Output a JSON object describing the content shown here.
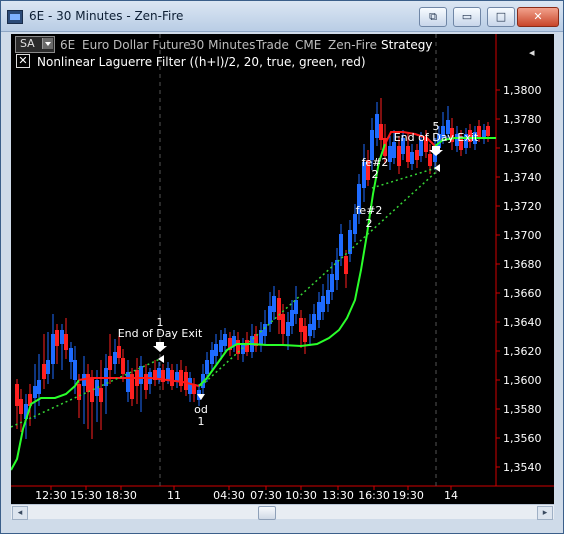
{
  "window": {
    "title": "6E - 30 Minutes - Zen-Fire",
    "min_symbol": "▭",
    "max_symbol": "□",
    "close_symbol": "✕",
    "extra_symbol": "⧉"
  },
  "header": {
    "account": "SA",
    "instrument": "6E",
    "description": "Euro Dollar Future",
    "interval": "30 Minutes",
    "type": "Trade",
    "exchange": "CME",
    "connection": "Zen-Fire",
    "mode": "Strategy",
    "indicator": "Nonlinear Laguerre Filter  ((h+l)/2,  20,  true,  green,  red)",
    "close_mark": "✕"
  },
  "axes": {
    "price_ticks": [
      "1,3800",
      "1,3780",
      "1,3760",
      "1,3740",
      "1,3720",
      "1,3700",
      "1,3680",
      "1,3660",
      "1,3640",
      "1,3620",
      "1,3600",
      "1,3580",
      "1,3560",
      "1,3540"
    ],
    "time_ticks": [
      "12:30",
      "15:30",
      "18:30",
      "11",
      "04:30",
      "07:30",
      "10:30",
      "13:30",
      "16:30",
      "19:30",
      "14"
    ],
    "pin_icon": "◂"
  },
  "annotations": {
    "exit1_label": "End of Day Exit",
    "exit1_count": "1",
    "exit2_label": "End of Day Exit",
    "exit2_count": "5",
    "entry1_label": "od",
    "entry1_count": "1",
    "fe_upper_label": "fe#2",
    "fe_upper_count": "2",
    "fe_lower_label": "fe#2",
    "fe_lower_count": "2"
  },
  "colors": {
    "up_candle": "#1e6bff",
    "down_candle": "#ff2020",
    "filter_up": "#2aff2a",
    "filter_down": "#ff1a1a",
    "trade_line": "#36d636"
  },
  "scrollbar": {
    "left_arrow": "◂",
    "right_arrow": "▸"
  }
}
